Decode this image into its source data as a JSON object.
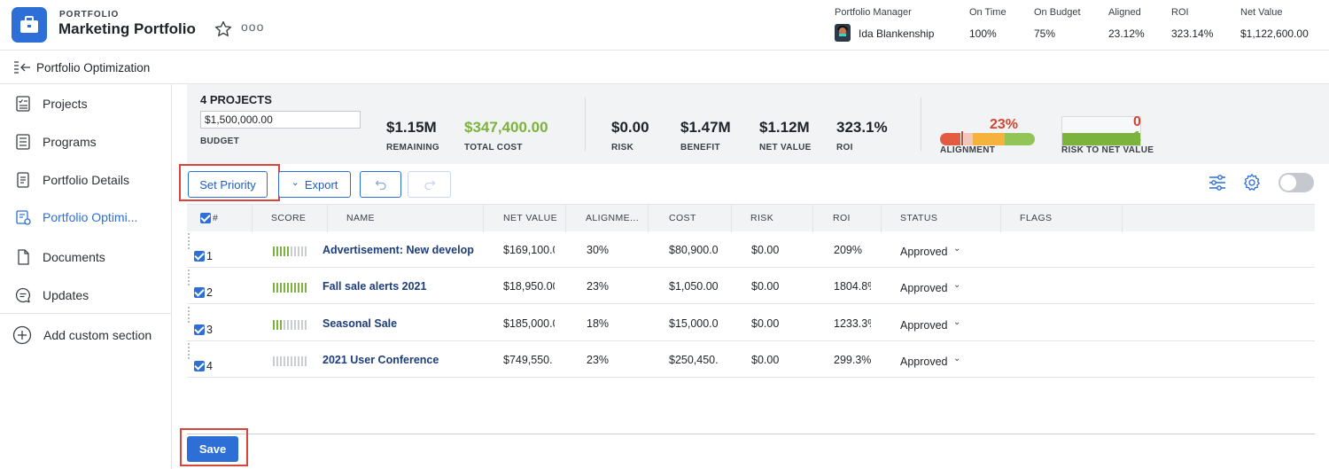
{
  "header": {
    "kicker": "PORTFOLIO",
    "title": "Marketing Portfolio",
    "more": "ooo",
    "meta": [
      {
        "label": "Portfolio Manager",
        "value": "Ida Blankenship"
      },
      {
        "label": "On Time",
        "value": "100%"
      },
      {
        "label": "On Budget",
        "value": "75%"
      },
      {
        "label": "Aligned",
        "value": "23.12%"
      },
      {
        "label": "ROI",
        "value": "323.14%"
      },
      {
        "label": "Net Value",
        "value": "$1,122,600.00"
      }
    ]
  },
  "subheader": {
    "title": "Portfolio Optimization"
  },
  "sidebar": {
    "items": [
      {
        "label": "Projects",
        "icon": "projects-icon"
      },
      {
        "label": "Programs",
        "icon": "programs-icon"
      },
      {
        "label": "Portfolio Details",
        "icon": "details-icon"
      },
      {
        "label": "Portfolio Optimi...",
        "icon": "optimization-icon",
        "active": true
      },
      {
        "label": "Documents",
        "icon": "documents-icon"
      },
      {
        "label": "Updates",
        "icon": "updates-icon"
      }
    ],
    "add_label": "Add custom section"
  },
  "summary": {
    "projects_count": "4 PROJECTS",
    "budget_value": "$1,500,000.00",
    "budget_label": "BUDGET",
    "kpis": [
      {
        "value": "$1.15M",
        "label": "REMAINING"
      },
      {
        "value": "$347,400.00",
        "label": "TOTAL COST"
      },
      {
        "value": "$0.00",
        "label": "RISK"
      },
      {
        "value": "$1.47M",
        "label": "BENEFIT"
      },
      {
        "value": "$1.12M",
        "label": "NET VALUE"
      },
      {
        "value": "323.1%",
        "label": "ROI"
      }
    ],
    "alignment_value": "23%",
    "alignment_label": "ALIGNMENT",
    "risk_top": "0",
    "risk_bottom": "1",
    "risk_label": "RISK TO NET VALUE"
  },
  "toolbar": {
    "set_priority": "Set Priority",
    "export": "Export",
    "export_chevron": "⌄"
  },
  "table": {
    "columns": [
      "#",
      "SCORE",
      "NAME",
      "NET VALUE",
      "ALIGNME...",
      "COST",
      "RISK",
      "ROI",
      "STATUS",
      "FLAGS"
    ],
    "rows": [
      {
        "num": "1",
        "score": 5,
        "name": "Advertisement: New developm",
        "net_value": "$169,100.0",
        "alignment": "30%",
        "cost": "$80,900.0",
        "risk": "$0.00",
        "roi": "209%",
        "status": "Approved"
      },
      {
        "num": "2",
        "score": 10,
        "name": "Fall sale alerts 2021",
        "net_value": "$18,950.00",
        "alignment": "23%",
        "cost": "$1,050.00",
        "risk": "$0.00",
        "roi": "1804.8%",
        "status": "Approved"
      },
      {
        "num": "3",
        "score": 3,
        "name": "Seasonal Sale",
        "net_value": "$185,000.0",
        "alignment": "18%",
        "cost": "$15,000.0",
        "risk": "$0.00",
        "roi": "1233.3%",
        "status": "Approved"
      },
      {
        "num": "4",
        "score": 0,
        "name": "2021 User Conference",
        "net_value": "$749,550.",
        "alignment": "23%",
        "cost": "$250,450.",
        "risk": "$0.00",
        "roi": "299.3%",
        "status": "Approved"
      }
    ]
  },
  "footer": {
    "save": "Save"
  },
  "colors": {
    "accent": "#2d6fd6",
    "positive": "#7bb33c",
    "negative": "#d64531",
    "highlight": "#d9453a"
  }
}
